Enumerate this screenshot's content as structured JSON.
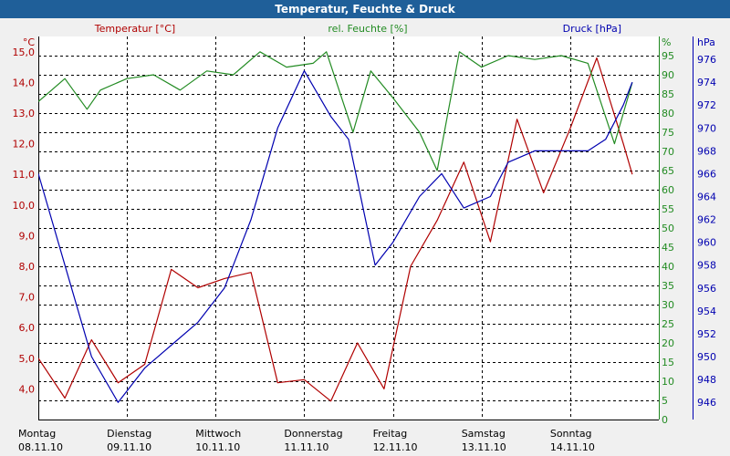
{
  "chart_data": {
    "type": "line",
    "title": "Temperatur, Feuchte & Druck",
    "colors": {
      "title_bar": "#1f5f99",
      "title_text": "#ffffff",
      "background": "#f0f0f0",
      "plot_background": "#ffffff",
      "grid": "#000000",
      "temperature": "#b00000",
      "humidity": "#228b22",
      "pressure": "#0000b0"
    },
    "grid": true,
    "series": [
      {
        "name": "Temperatur [°C]",
        "axis": "left",
        "x": [
          0,
          0.3,
          0.6,
          0.9,
          1.2,
          1.5,
          1.8,
          2.1,
          2.4,
          2.7,
          3.0,
          3.3,
          3.6,
          3.9,
          4.2,
          4.5,
          4.8,
          5.1,
          5.4,
          5.7,
          6.0,
          6.3,
          6.6,
          6.7
        ],
        "values": [
          5.0,
          3.7,
          5.6,
          4.2,
          4.8,
          7.9,
          7.3,
          7.6,
          7.8,
          4.2,
          4.3,
          3.6,
          5.5,
          4.0,
          8.0,
          9.5,
          11.4,
          8.8,
          12.8,
          10.4,
          12.5,
          14.8,
          12.0,
          11.0
        ]
      },
      {
        "name": "rel. Feuchte [%]",
        "axis": "right1",
        "x": [
          0,
          0.3,
          0.55,
          0.7,
          1.0,
          1.3,
          1.6,
          1.9,
          2.2,
          2.5,
          2.8,
          3.1,
          3.25,
          3.55,
          3.75,
          4.0,
          4.3,
          4.5,
          4.75,
          5.0,
          5.3,
          5.6,
          5.9,
          6.2,
          6.5,
          6.7
        ],
        "values": [
          83,
          89,
          81,
          86,
          89,
          90,
          86,
          91,
          90,
          96,
          92,
          93,
          96,
          75,
          91,
          84,
          75,
          65,
          96,
          92,
          95,
          94,
          95,
          93,
          72,
          88
        ]
      },
      {
        "name": "Druck [hPa]",
        "axis": "right2",
        "x": [
          0,
          0.3,
          0.6,
          0.9,
          1.2,
          1.5,
          1.8,
          2.1,
          2.4,
          2.7,
          3.0,
          3.3,
          3.5,
          3.8,
          4.0,
          4.3,
          4.55,
          4.8,
          5.1,
          5.3,
          5.6,
          5.9,
          6.2,
          6.4,
          6.6,
          6.7
        ],
        "values": [
          966,
          958,
          950,
          946,
          949,
          951,
          953,
          956,
          962,
          970,
          975,
          971,
          969,
          958,
          960,
          964,
          966,
          963,
          964,
          967,
          968,
          968,
          968,
          969,
          972,
          974
        ]
      }
    ],
    "axes": {
      "left": {
        "label": "Temperatur [°C]",
        "unit": "°C",
        "ylim": [
          3.0,
          15.5
        ],
        "ticks": [
          "4,0",
          "5,0",
          "6,0",
          "7,0",
          "8,0",
          "9,0",
          "10,0",
          "11,0",
          "12,0",
          "13,0",
          "14,0",
          "15,0"
        ]
      },
      "right1": {
        "label": "rel. Feuchte [%]",
        "unit": "%",
        "ylim": [
          0,
          100
        ],
        "ticks": [
          "0",
          "5",
          "10",
          "15",
          "20",
          "25",
          "30",
          "35",
          "40",
          "45",
          "50",
          "55",
          "60",
          "65",
          "70",
          "75",
          "80",
          "85",
          "90",
          "95"
        ]
      },
      "right2": {
        "label": "Druck [hPa]",
        "unit": "hPa",
        "ylim": [
          944.5,
          978
        ],
        "ticks": [
          "946",
          "948",
          "950",
          "952",
          "954",
          "956",
          "958",
          "960",
          "962",
          "964",
          "966",
          "968",
          "970",
          "972",
          "974",
          "976"
        ]
      }
    },
    "x_axis": {
      "range": [
        0,
        7.0
      ],
      "day_labels": [
        "Montag",
        "Dienstag",
        "Mittwoch",
        "Donnerstag",
        "Freitag",
        "Samstag",
        "Sonntag"
      ],
      "date_labels": [
        "08.11.10",
        "09.11.10",
        "10.11.10",
        "11.11.10",
        "12.11.10",
        "13.11.10",
        "14.11.10"
      ]
    }
  }
}
